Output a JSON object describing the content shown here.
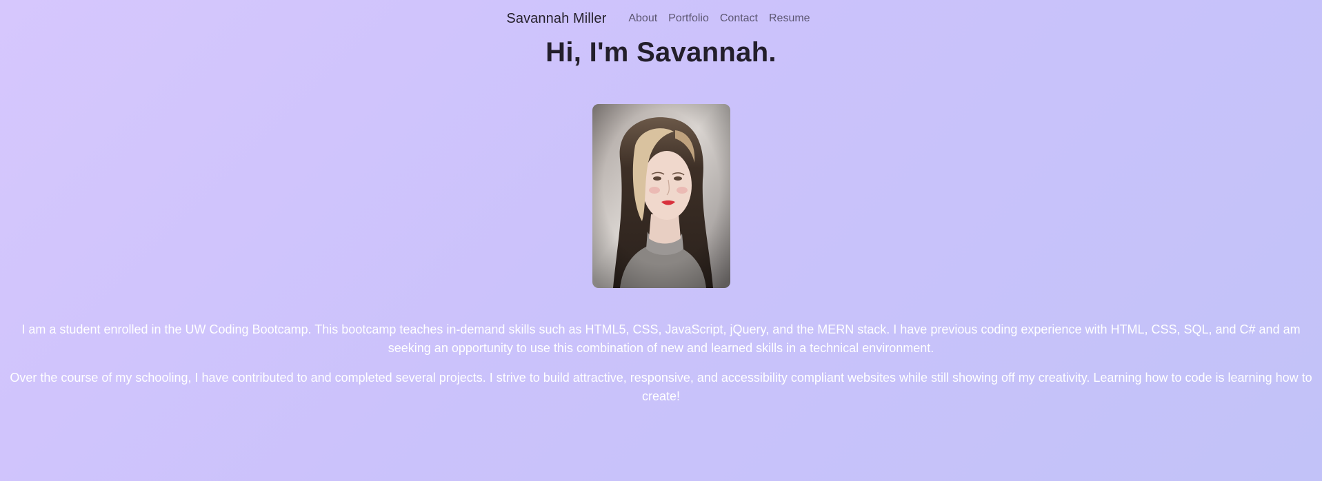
{
  "nav": {
    "brand": "Savannah Miller",
    "links": [
      "About",
      "Portfolio",
      "Contact",
      "Resume"
    ]
  },
  "hero": {
    "heading": "Hi, I'm Savannah.",
    "photo_alt": "photo"
  },
  "about": {
    "paragraphs": [
      "I am a student enrolled in the UW Coding Bootcamp. This bootcamp teaches in-demand skills such as HTML5, CSS, JavaScript, jQuery, and the MERN stack. I have previous coding experience with HTML, CSS, SQL, and C# and am seeking an opportunity to use this combination of new and learned skills in a technical environment.",
      "Over the course of my schooling, I have contributed to and completed several projects. I strive to build attractive, responsive, and accessibility compliant websites while still showing off my creativity. Learning how to code is learning how to create!"
    ]
  },
  "colors": {
    "background_start": "#d6c7fd",
    "background_end": "#c2c2f8",
    "heading": "#231f2b",
    "nav_link": "#5d5773",
    "body_text": "#ffffff"
  }
}
